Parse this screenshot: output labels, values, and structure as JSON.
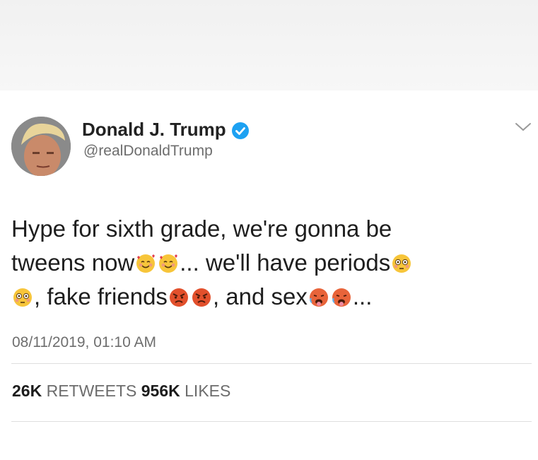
{
  "tweet": {
    "display_name": "Donald J. Trump",
    "handle": "@realDonaldTrump",
    "verified": true,
    "text_line1": "Hype for sixth grade, we're gonna be",
    "text_line2_a": "tweens now",
    "text_line2_b": "... we'll have periods",
    "text_line3_a": ", fake friends",
    "text_line3_b": ", and sex",
    "text_line3_c": "...",
    "emojis": [
      "smiling-face-with-hearts",
      "flushed-face",
      "angry-face",
      "hot-face"
    ],
    "timestamp": "08/11/2019, 01:10 AM",
    "retweets_count": "26K",
    "retweets_label": "RETWEETS",
    "likes_count": "956K",
    "likes_label": "LIKES"
  },
  "colors": {
    "verified_badge": "#1da1f2",
    "emoji_yellow": "#f7c53a",
    "angry_red": "#e2502c",
    "hot_red": "#e8643a"
  }
}
